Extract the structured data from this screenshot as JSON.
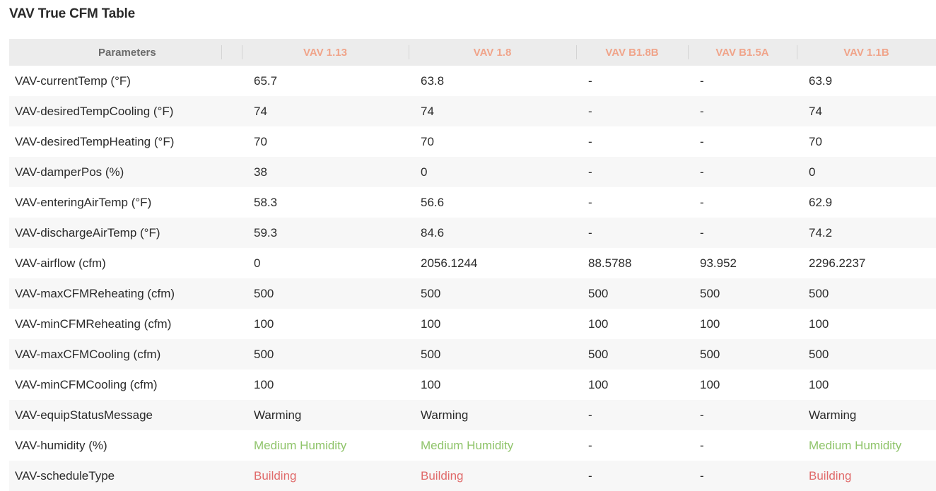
{
  "page": {
    "title": "VAV True CFM Table"
  },
  "colors": {
    "header_bg": "#ececec",
    "header_param_text": "#6b6b6b",
    "header_vav_text": "#f0a48a",
    "zebra_row": "#f7f7f7",
    "humidity_text": "#8fc46a",
    "schedule_text": "#e06a6a"
  },
  "table": {
    "param_header": "Parameters",
    "columns": [
      "VAV 1.13",
      "VAV 1.8",
      "VAV B1.8B",
      "VAV B1.5A",
      "VAV 1.1B"
    ],
    "rows": [
      {
        "param": "VAV-currentTemp  (°F)",
        "values": [
          "65.7",
          "63.8",
          "-",
          "-",
          "63.9"
        ],
        "tone": ""
      },
      {
        "param": "VAV-desiredTempCooling  (°F)",
        "values": [
          "74",
          "74",
          "-",
          "-",
          "74"
        ],
        "tone": ""
      },
      {
        "param": "VAV-desiredTempHeating  (°F)",
        "values": [
          "70",
          "70",
          "-",
          "-",
          "70"
        ],
        "tone": ""
      },
      {
        "param": "VAV-damperPos  (%)",
        "values": [
          "38",
          "0",
          "-",
          "-",
          "0"
        ],
        "tone": ""
      },
      {
        "param": "VAV-enteringAirTemp  (°F)",
        "values": [
          "58.3",
          "56.6",
          "-",
          "-",
          "62.9"
        ],
        "tone": ""
      },
      {
        "param": "VAV-dischargeAirTemp  (°F)",
        "values": [
          "59.3",
          "84.6",
          "-",
          "-",
          "74.2"
        ],
        "tone": ""
      },
      {
        "param": "VAV-airflow  (cfm)",
        "values": [
          "0",
          "2056.1244",
          "88.5788",
          "93.952",
          "2296.2237"
        ],
        "tone": ""
      },
      {
        "param": "VAV-maxCFMReheating  (cfm)",
        "values": [
          "500",
          "500",
          "500",
          "500",
          "500"
        ],
        "tone": ""
      },
      {
        "param": "VAV-minCFMReheating  (cfm)",
        "values": [
          "100",
          "100",
          "100",
          "100",
          "100"
        ],
        "tone": ""
      },
      {
        "param": "VAV-maxCFMCooling  (cfm)",
        "values": [
          "500",
          "500",
          "500",
          "500",
          "500"
        ],
        "tone": ""
      },
      {
        "param": "VAV-minCFMCooling  (cfm)",
        "values": [
          "100",
          "100",
          "100",
          "100",
          "100"
        ],
        "tone": ""
      },
      {
        "param": "VAV-equipStatusMessage",
        "values": [
          "Warming",
          "Warming",
          "-",
          "-",
          "Warming"
        ],
        "tone": ""
      },
      {
        "param": "VAV-humidity  (%)",
        "values": [
          "Medium Humidity",
          "Medium Humidity",
          "-",
          "-",
          "Medium Humidity"
        ],
        "tone": "green"
      },
      {
        "param": "VAV-scheduleType",
        "values": [
          "Building",
          "Building",
          "-",
          "-",
          "Building"
        ],
        "tone": "red"
      }
    ]
  }
}
